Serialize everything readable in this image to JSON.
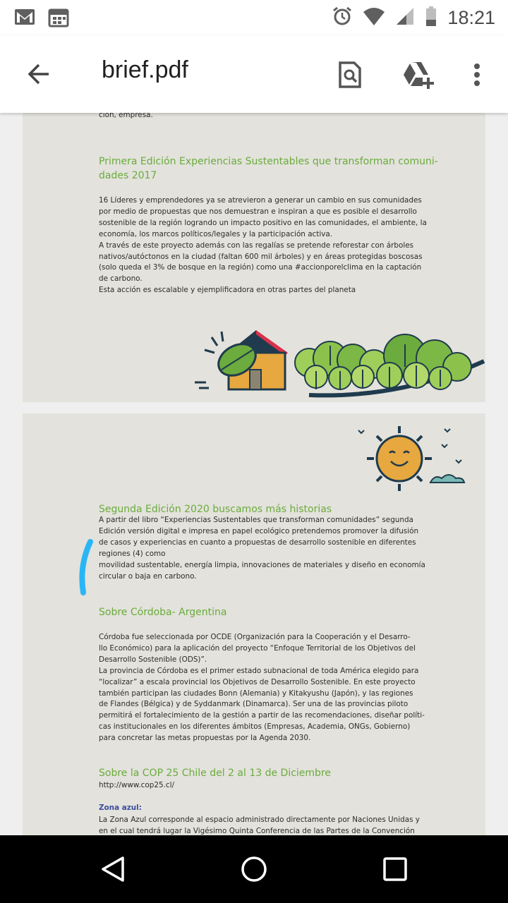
{
  "status_bar": {
    "time": "18:21",
    "left_icons": [
      "gmail-icon",
      "calendar-icon"
    ],
    "right_icons": [
      "alarm-icon",
      "wifi-icon",
      "signal-icon",
      "battery-icon"
    ]
  },
  "app_bar": {
    "title": "brief.pdf",
    "actions": [
      "search-document-icon",
      "add-to-drive-icon",
      "more-options-icon"
    ]
  },
  "document": {
    "page1": {
      "top_fragment": "ción, empresa.",
      "heading": "Primera Edición Experiencias Sustentables que transforman comuni-\ndades 2017",
      "body": "16 Líderes y emprendedores ya se atrevieron a generar un cambio en sus comunidades\npor medio de propuestas que nos demuestran e inspiran a que es posible el desarrollo\nsostenible de la región logrando un impacto positivo en las comunidades, el ambiente, la\neconomía, los marcos políticos/legales y la participación activa.\nA través de este proyecto además con las regalías se pretende reforestar con árboles\nnativos/autóctonos en la ciudad (faltan 600 mil árboles) y en áreas protegidas boscosas\n(solo queda el 3% de bosque en la región) como una #accionporelclima en la captación\nde carbono.\nEsta acción es escalable y ejemplificadora en otras partes del planeta"
    },
    "page2": {
      "section1_heading": "Segunda Edición 2020 buscamos más historias",
      "section1_body": "A partir del libro “Experiencias Sustentables que transforman comunidades” segunda\nEdición versión digital e impresa en papel ecológico pretendemos promover la difusión\nde casos y experiencias en cuanto a propuestas de desarrollo sostenible en diferentes\nregiones (4) como\nmovilidad sustentable, energía limpia, innovaciones de materiales y diseño en economía\ncircular o baja en carbono.",
      "section2_heading": "Sobre Córdoba- Argentina",
      "section2_body": "Córdoba fue seleccionada por OCDE (Organización para la Cooperación y el Desarro-\nllo Económico) para la aplicación del proyecto “Enfoque Territorial de los Objetivos del\nDesarrollo Sostenible (ODS)”.\nLa provincia de Córdoba es el primer estado subnacional de toda América elegido para\n“localizar” a escala provincial los Objetivos de Desarrollo Sostenible. En este proyecto\ntambién participan las ciudades Bonn (Alemania) y Kitakyushu (Japón), y las regiones\nde Flandes (Bélgica) y de Syddanmark (Dinamarca). Ser una de las provincias piloto\npermitirá el fortalecimiento de la gestión a partir de las recomendaciones, diseñar políti-\ncas institucionales en los diferentes ámbitos (Empresas, Academia, ONGs, Gobierno)\npara concretar las metas propuestas por la Agenda 2030.",
      "section3_heading": "Sobre la COP 25 Chile del 2 al 13 de Diciembre",
      "section3_link": "http://www.cop25.cl/",
      "zona_label": "Zona azul:",
      "zona_body": "La Zona Azul corresponde al espacio administrado directamente por Naciones Unidas y\nen el cual tendrá lugar la Vigésimo Quinta Conferencia de las Partes de la Convención"
    }
  },
  "colors": {
    "page_background": "#e3e2dc",
    "heading_green": "#6bab3d",
    "zona_blue": "#3b4e9e",
    "annotation_blue": "#29b6f6"
  },
  "nav_bar": {
    "buttons": [
      "back-triangle-icon",
      "home-circle-icon",
      "recents-square-icon"
    ]
  }
}
